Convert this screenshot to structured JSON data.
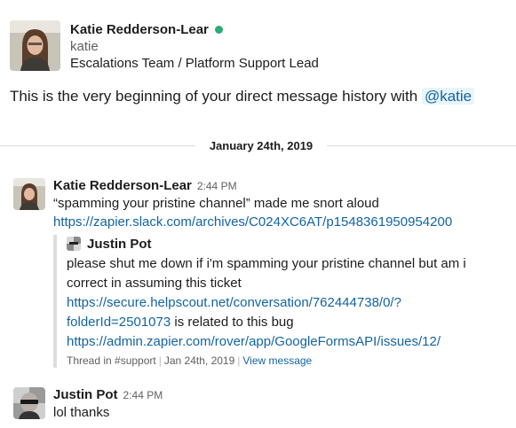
{
  "profile": {
    "name": "Katie Redderson-Lear",
    "handle": "katie",
    "title": "Escalations Team / Platform Support Lead",
    "presence_color": "#2bac76"
  },
  "intro": {
    "text": "This is the very beginning of your direct message history with ",
    "mention": "@katie"
  },
  "date_divider": "January 24th, 2019",
  "messages": [
    {
      "author": "Katie Redderson-Lear",
      "time": "2:44 PM",
      "text": "“spamming your pristine channel” made me snort aloud",
      "link": "https://zapier.slack.com/archives/C024XC6AT/p1548361950954200",
      "quote": {
        "author": "Justin Pot",
        "line1": "please shut me down if i'm spamming your pristine channel but am i",
        "line2": "correct in assuming this ticket",
        "link1_part1": "https://secure.helpscout.net/conversation/762444738/0/?",
        "link1_part2": "folderId=2501073",
        "after_link1": " is related to this bug",
        "link2": "https://admin.zapier.com/rover/app/GoogleFormsAPI/issues/12/",
        "footer_source": "Thread in #support",
        "footer_date": "Jan 24th, 2019",
        "footer_link": "View message"
      }
    },
    {
      "author": "Justin Pot",
      "time": "2:44 PM",
      "text": "lol thanks"
    }
  ]
}
